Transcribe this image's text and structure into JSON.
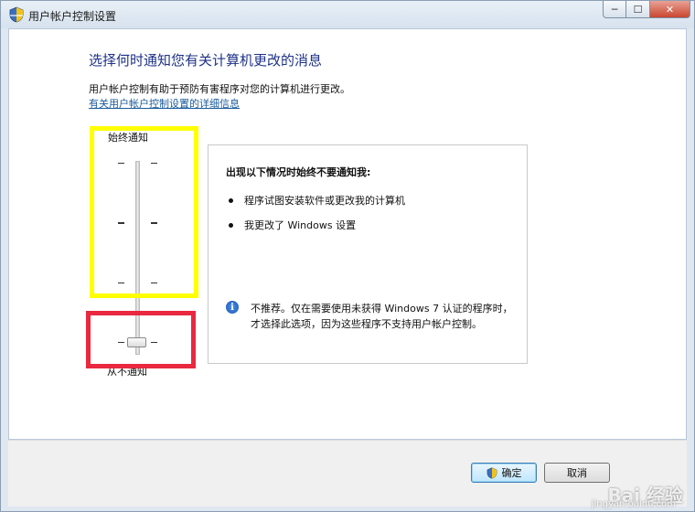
{
  "window": {
    "title": "用户帐户控制设置",
    "min_label": "─",
    "max_label": "☐",
    "close_label": "✕"
  },
  "content": {
    "heading": "选择何时通知您有关计算机更改的消息",
    "description": "用户帐户控制有助于预防有害程序对您的计算机进行更改。",
    "more_link": "有关用户帐户控制设置的详细信息"
  },
  "slider": {
    "top_label": "始终通知",
    "bottom_label": "从不通知",
    "level_count": 4,
    "selected_level": 0
  },
  "panel": {
    "title": "出现以下情况时始终不要通知我:",
    "bullets": [
      "程序试图安装软件或更改我的计算机",
      "我更改了 Windows 设置"
    ],
    "info_icon": "i",
    "info_text": "不推荐。仅在需要使用未获得 Windows 7 认证的程序时，才选择此选项，因为这些程序不支持用户帐户控制。"
  },
  "buttons": {
    "ok_label": "确定",
    "cancel_label": "取消"
  },
  "watermark": {
    "text": "Bai 经验",
    "url": "jingyan.baidu.com"
  },
  "colors": {
    "heading": "#1e3287",
    "highlight_yellow": "#ffff00",
    "highlight_red": "#e8293f"
  }
}
